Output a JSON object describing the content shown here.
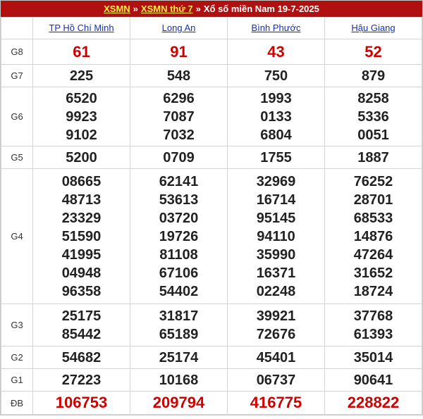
{
  "header": {
    "link1": "XSMN",
    "sep1": "»",
    "link2": "XSMN thứ 7",
    "sep2": "»",
    "title": "Xổ số miền Nam 19-7-2025"
  },
  "provinces": [
    "TP Hồ Chí Minh",
    "Long An",
    "Bình Phước",
    "Hậu Giang"
  ],
  "prizes": {
    "g8": {
      "label": "G8",
      "values": [
        [
          "61"
        ],
        [
          "91"
        ],
        [
          "43"
        ],
        [
          "52"
        ]
      ]
    },
    "g7": {
      "label": "G7",
      "values": [
        [
          "225"
        ],
        [
          "548"
        ],
        [
          "750"
        ],
        [
          "879"
        ]
      ]
    },
    "g6": {
      "label": "G6",
      "values": [
        [
          "6520",
          "9923",
          "9102"
        ],
        [
          "6296",
          "7087",
          "7032"
        ],
        [
          "1993",
          "0133",
          "6804"
        ],
        [
          "8258",
          "5336",
          "0051"
        ]
      ]
    },
    "g5": {
      "label": "G5",
      "values": [
        [
          "5200"
        ],
        [
          "0709"
        ],
        [
          "1755"
        ],
        [
          "1887"
        ]
      ]
    },
    "g4": {
      "label": "G4",
      "values": [
        [
          "08665",
          "48713",
          "23329",
          "51590",
          "41995",
          "04948",
          "96358"
        ],
        [
          "62141",
          "53613",
          "03720",
          "19726",
          "81108",
          "67106",
          "54402"
        ],
        [
          "32969",
          "16714",
          "95145",
          "94110",
          "35990",
          "16371",
          "02248"
        ],
        [
          "76252",
          "28701",
          "68533",
          "14876",
          "47264",
          "31652",
          "18724"
        ]
      ]
    },
    "g3": {
      "label": "G3",
      "values": [
        [
          "25175",
          "85442"
        ],
        [
          "31817",
          "65189"
        ],
        [
          "39921",
          "72676"
        ],
        [
          "37768",
          "61393"
        ]
      ]
    },
    "g2": {
      "label": "G2",
      "values": [
        [
          "54682"
        ],
        [
          "25174"
        ],
        [
          "45401"
        ],
        [
          "35014"
        ]
      ]
    },
    "g1": {
      "label": "G1",
      "values": [
        [
          "27223"
        ],
        [
          "10168"
        ],
        [
          "06737"
        ],
        [
          "90641"
        ]
      ]
    },
    "db": {
      "label": "ĐB",
      "values": [
        [
          "106753"
        ],
        [
          "209794"
        ],
        [
          "416775"
        ],
        [
          "228822"
        ]
      ]
    }
  },
  "colors": {
    "header_bg": "#b0100f",
    "header_link": "#ffec3f",
    "province_link": "#1530b7",
    "highlight": "#d10000"
  }
}
